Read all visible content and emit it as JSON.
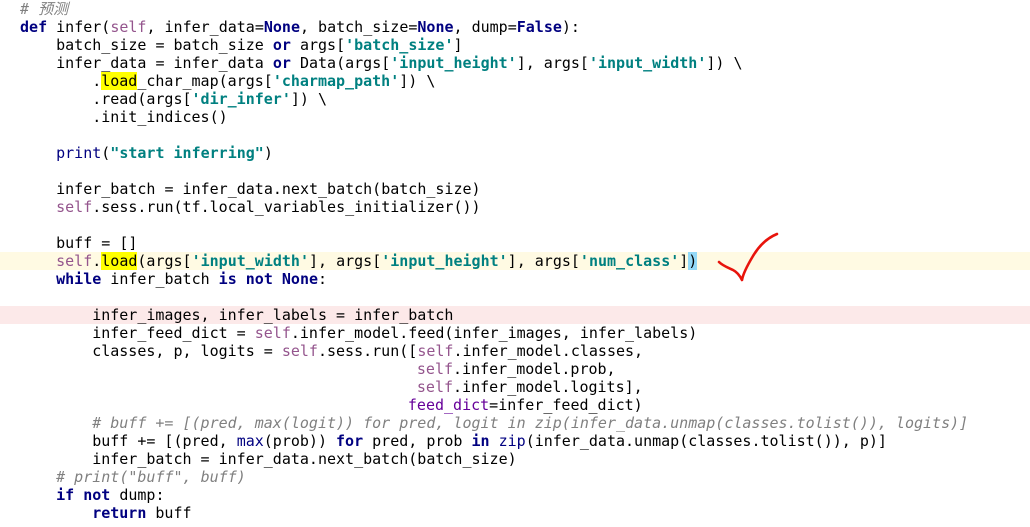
{
  "editor": {
    "language": "python",
    "colors": {
      "background": "#ffffff",
      "caret_line": "#fffae3",
      "error_line": "#fce9e9",
      "keyword": "#000080",
      "self": "#94558d",
      "string": "#008080",
      "parameter": "#660099",
      "comment": "#808080",
      "usage_highlight": "#ffff00",
      "brace_match": "#93d9f8",
      "annotation_mark": "#e8140c"
    },
    "lines": [
      {
        "indent": 2,
        "tokens": [
          {
            "t": "# 预测",
            "c": "cm"
          }
        ]
      },
      {
        "indent": 2,
        "tokens": [
          {
            "t": "def",
            "c": "kw"
          },
          {
            "t": " infer("
          },
          {
            "t": "self",
            "c": "self"
          },
          {
            "t": ", infer_data="
          },
          {
            "t": "None",
            "c": "kw"
          },
          {
            "t": ", batch_size="
          },
          {
            "t": "None",
            "c": "kw"
          },
          {
            "t": ", dump="
          },
          {
            "t": "False",
            "c": "kw"
          },
          {
            "t": "):"
          }
        ]
      },
      {
        "indent": 6,
        "tokens": [
          {
            "t": "batch_size = batch_size "
          },
          {
            "t": "or",
            "c": "kw"
          },
          {
            "t": " args["
          },
          {
            "t": "'batch_size'",
            "c": "str"
          },
          {
            "t": "]"
          }
        ]
      },
      {
        "indent": 6,
        "tokens": [
          {
            "t": "infer_data = infer_data "
          },
          {
            "t": "or",
            "c": "kw"
          },
          {
            "t": " Data(args["
          },
          {
            "t": "'input_height'",
            "c": "str"
          },
          {
            "t": "], args["
          },
          {
            "t": "'input_width'",
            "c": "str"
          },
          {
            "t": "]) \\"
          }
        ]
      },
      {
        "indent": 10,
        "tokens": [
          {
            "t": "."
          },
          {
            "t": "load",
            "c": "hl"
          },
          {
            "t": "_char_map(args["
          },
          {
            "t": "'charmap_path'",
            "c": "str"
          },
          {
            "t": "]) \\"
          }
        ]
      },
      {
        "indent": 10,
        "tokens": [
          {
            "t": ".read(args["
          },
          {
            "t": "'dir_infer'",
            "c": "str"
          },
          {
            "t": "]) \\"
          }
        ]
      },
      {
        "indent": 10,
        "tokens": [
          {
            "t": ".init_indices()"
          }
        ]
      },
      {
        "indent": 0,
        "tokens": []
      },
      {
        "indent": 6,
        "tokens": [
          {
            "t": "print",
            "c": "bi"
          },
          {
            "t": "("
          },
          {
            "t": "\"start inferring\"",
            "c": "str"
          },
          {
            "t": ")"
          }
        ]
      },
      {
        "indent": 0,
        "tokens": []
      },
      {
        "indent": 6,
        "tokens": [
          {
            "t": "infer_batch = infer_data.next_batch(batch_size)"
          }
        ]
      },
      {
        "indent": 6,
        "tokens": [
          {
            "t": "self",
            "c": "self"
          },
          {
            "t": ".sess.run(tf.local_variables_initializer())"
          }
        ]
      },
      {
        "indent": 0,
        "tokens": []
      },
      {
        "indent": 6,
        "tokens": [
          {
            "t": "buff = []"
          }
        ]
      },
      {
        "indent": 6,
        "row": "caret",
        "tokens": [
          {
            "t": "self",
            "c": "self"
          },
          {
            "t": "."
          },
          {
            "t": "load",
            "c": "hl"
          },
          {
            "t": "(args["
          },
          {
            "t": "'input_width'",
            "c": "str"
          },
          {
            "t": "], args["
          },
          {
            "t": "'input_height'",
            "c": "str"
          },
          {
            "t": "], args["
          },
          {
            "t": "'num_class'",
            "c": "str"
          },
          {
            "t": "]"
          },
          {
            "t": ")",
            "c": "mb"
          }
        ]
      },
      {
        "indent": 6,
        "tokens": [
          {
            "t": "while",
            "c": "kw"
          },
          {
            "t": " infer_batch "
          },
          {
            "t": "is not None",
            "c": "kw"
          },
          {
            "t": ":"
          }
        ]
      },
      {
        "indent": 0,
        "tokens": []
      },
      {
        "indent": 10,
        "row": "err",
        "tokens": [
          {
            "t": "infer_images, infer_labels = infer_batch"
          }
        ]
      },
      {
        "indent": 10,
        "tokens": [
          {
            "t": "infer_feed_dict = "
          },
          {
            "t": "self",
            "c": "self"
          },
          {
            "t": ".infer_model.feed(infer_images, infer_labels)"
          }
        ]
      },
      {
        "indent": 10,
        "tokens": [
          {
            "t": "classes, p, logits = "
          },
          {
            "t": "self",
            "c": "self"
          },
          {
            "t": ".sess.run(["
          },
          {
            "t": "self",
            "c": "self"
          },
          {
            "t": ".infer_model.classes,"
          }
        ]
      },
      {
        "indent": 46,
        "tokens": [
          {
            "t": "self",
            "c": "self"
          },
          {
            "t": ".infer_model.prob,"
          }
        ]
      },
      {
        "indent": 46,
        "tokens": [
          {
            "t": "self",
            "c": "self"
          },
          {
            "t": ".infer_model.logits],"
          }
        ]
      },
      {
        "indent": 45,
        "tokens": [
          {
            "t": "feed_dict",
            "c": "param"
          },
          {
            "t": "=infer_feed_dict)"
          }
        ]
      },
      {
        "indent": 10,
        "tokens": [
          {
            "t": "# buff += [(pred, max(logit)) for pred, logit in zip(infer_data.unmap(classes.tolist()), logits)]",
            "c": "cm"
          }
        ]
      },
      {
        "indent": 10,
        "tokens": [
          {
            "t": "buff += [(pred, "
          },
          {
            "t": "max",
            "c": "bi"
          },
          {
            "t": "(prob)) "
          },
          {
            "t": "for",
            "c": "kw"
          },
          {
            "t": " pred, prob "
          },
          {
            "t": "in",
            "c": "kw"
          },
          {
            "t": " "
          },
          {
            "t": "zip",
            "c": "bi"
          },
          {
            "t": "(infer_data.unmap(classes.tolist()), p)]"
          }
        ]
      },
      {
        "indent": 10,
        "tokens": [
          {
            "t": "infer_batch = infer_data.next_batch(batch_size)"
          }
        ]
      },
      {
        "indent": 6,
        "tokens": [
          {
            "t": "# print(\"buff\", buff)",
            "c": "cm"
          }
        ]
      },
      {
        "indent": 6,
        "tokens": [
          {
            "t": "if not",
            "c": "kw"
          },
          {
            "t": " dump:"
          }
        ]
      },
      {
        "indent": 10,
        "tokens": [
          {
            "t": "return",
            "c": "kw"
          },
          {
            "t": " buff"
          }
        ]
      }
    ]
  },
  "annotation": {
    "icon": "red-checkmark-icon",
    "color": "#e8140c"
  }
}
